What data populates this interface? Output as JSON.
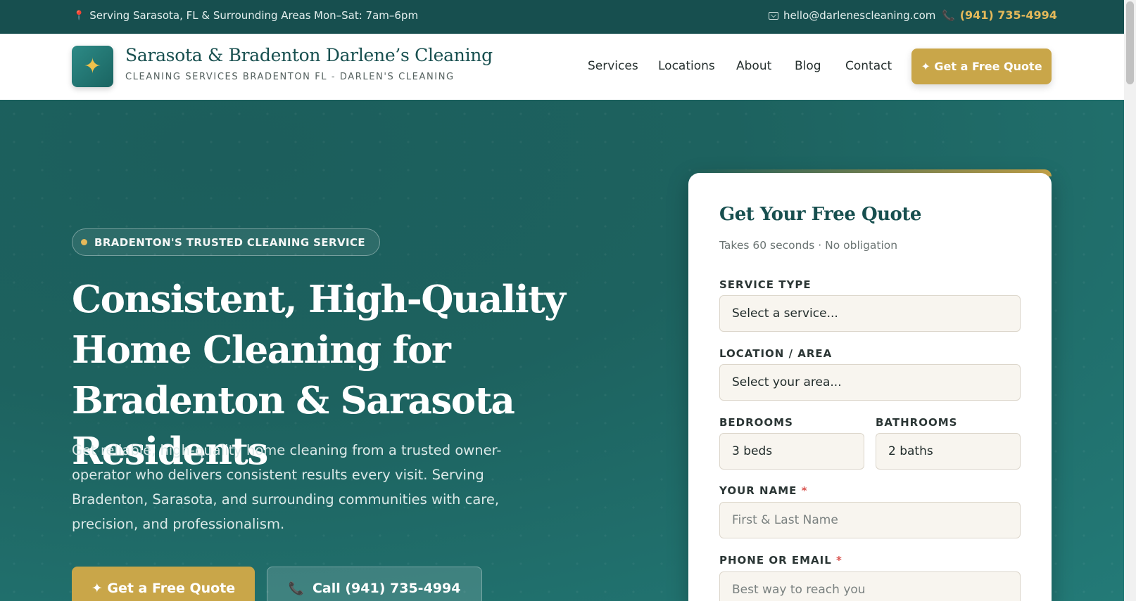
{
  "topbar": {
    "location": "Serving Sarasota, FL & Surrounding Areas",
    "hours": "Mon–Sat: 7am–6pm",
    "email": "hello@darlenescleaning.com",
    "phone": "(941) 735-4994",
    "pin_icon": "map-pin-icon",
    "mail_icon": "mail-icon",
    "phone_icon": "phone-icon"
  },
  "header": {
    "logo_icon": "sparkle-icon",
    "brand_title": "Sarasota & Bradenton Darlene’s Cleaning",
    "brand_subtitle": "CLEANING SERVICES BRADENTON FL - DARLEN'S CLEANING",
    "nav": [
      {
        "label": "Services"
      },
      {
        "label": "Locations"
      },
      {
        "label": "About"
      },
      {
        "label": "Blog"
      },
      {
        "label": "Contact"
      }
    ],
    "cta_label": "✦ Get a Free Quote"
  },
  "hero": {
    "badge": "BRADENTON'S TRUSTED CLEANING SERVICE",
    "title": "Consistent, High-Quality Home Cleaning for Bradenton & Sarasota Residents",
    "description": "Get reliable, high-quality home cleaning from a trusted owner-operator who delivers consistent results every visit. Serving Bradenton, Sarasota, and surrounding communities with care, precision, and professionalism.",
    "primary_button": "✦ Get a Free Quote",
    "secondary_button": "Call (941) 735-4994"
  },
  "quote_form": {
    "title": "Get Your Free Quote",
    "subtitle": "Takes 60 seconds · No obligation",
    "service_type": {
      "label": "SERVICE TYPE",
      "value": "Select a service..."
    },
    "location": {
      "label": "LOCATION / AREA",
      "value": "Select your area..."
    },
    "bedrooms": {
      "label": "BEDROOMS",
      "value": "3 beds"
    },
    "bathrooms": {
      "label": "BATHROOMS",
      "value": "2 baths"
    },
    "name": {
      "label": "YOUR NAME",
      "required": "*",
      "placeholder": "First & Last Name"
    },
    "contact": {
      "label": "PHONE OR EMAIL",
      "required": "*",
      "placeholder": "Best way to reach you"
    }
  },
  "colors": {
    "brand_teal": "#174f4f",
    "accent_gold": "#c9a649",
    "hero_bg": "#1f6a67"
  }
}
